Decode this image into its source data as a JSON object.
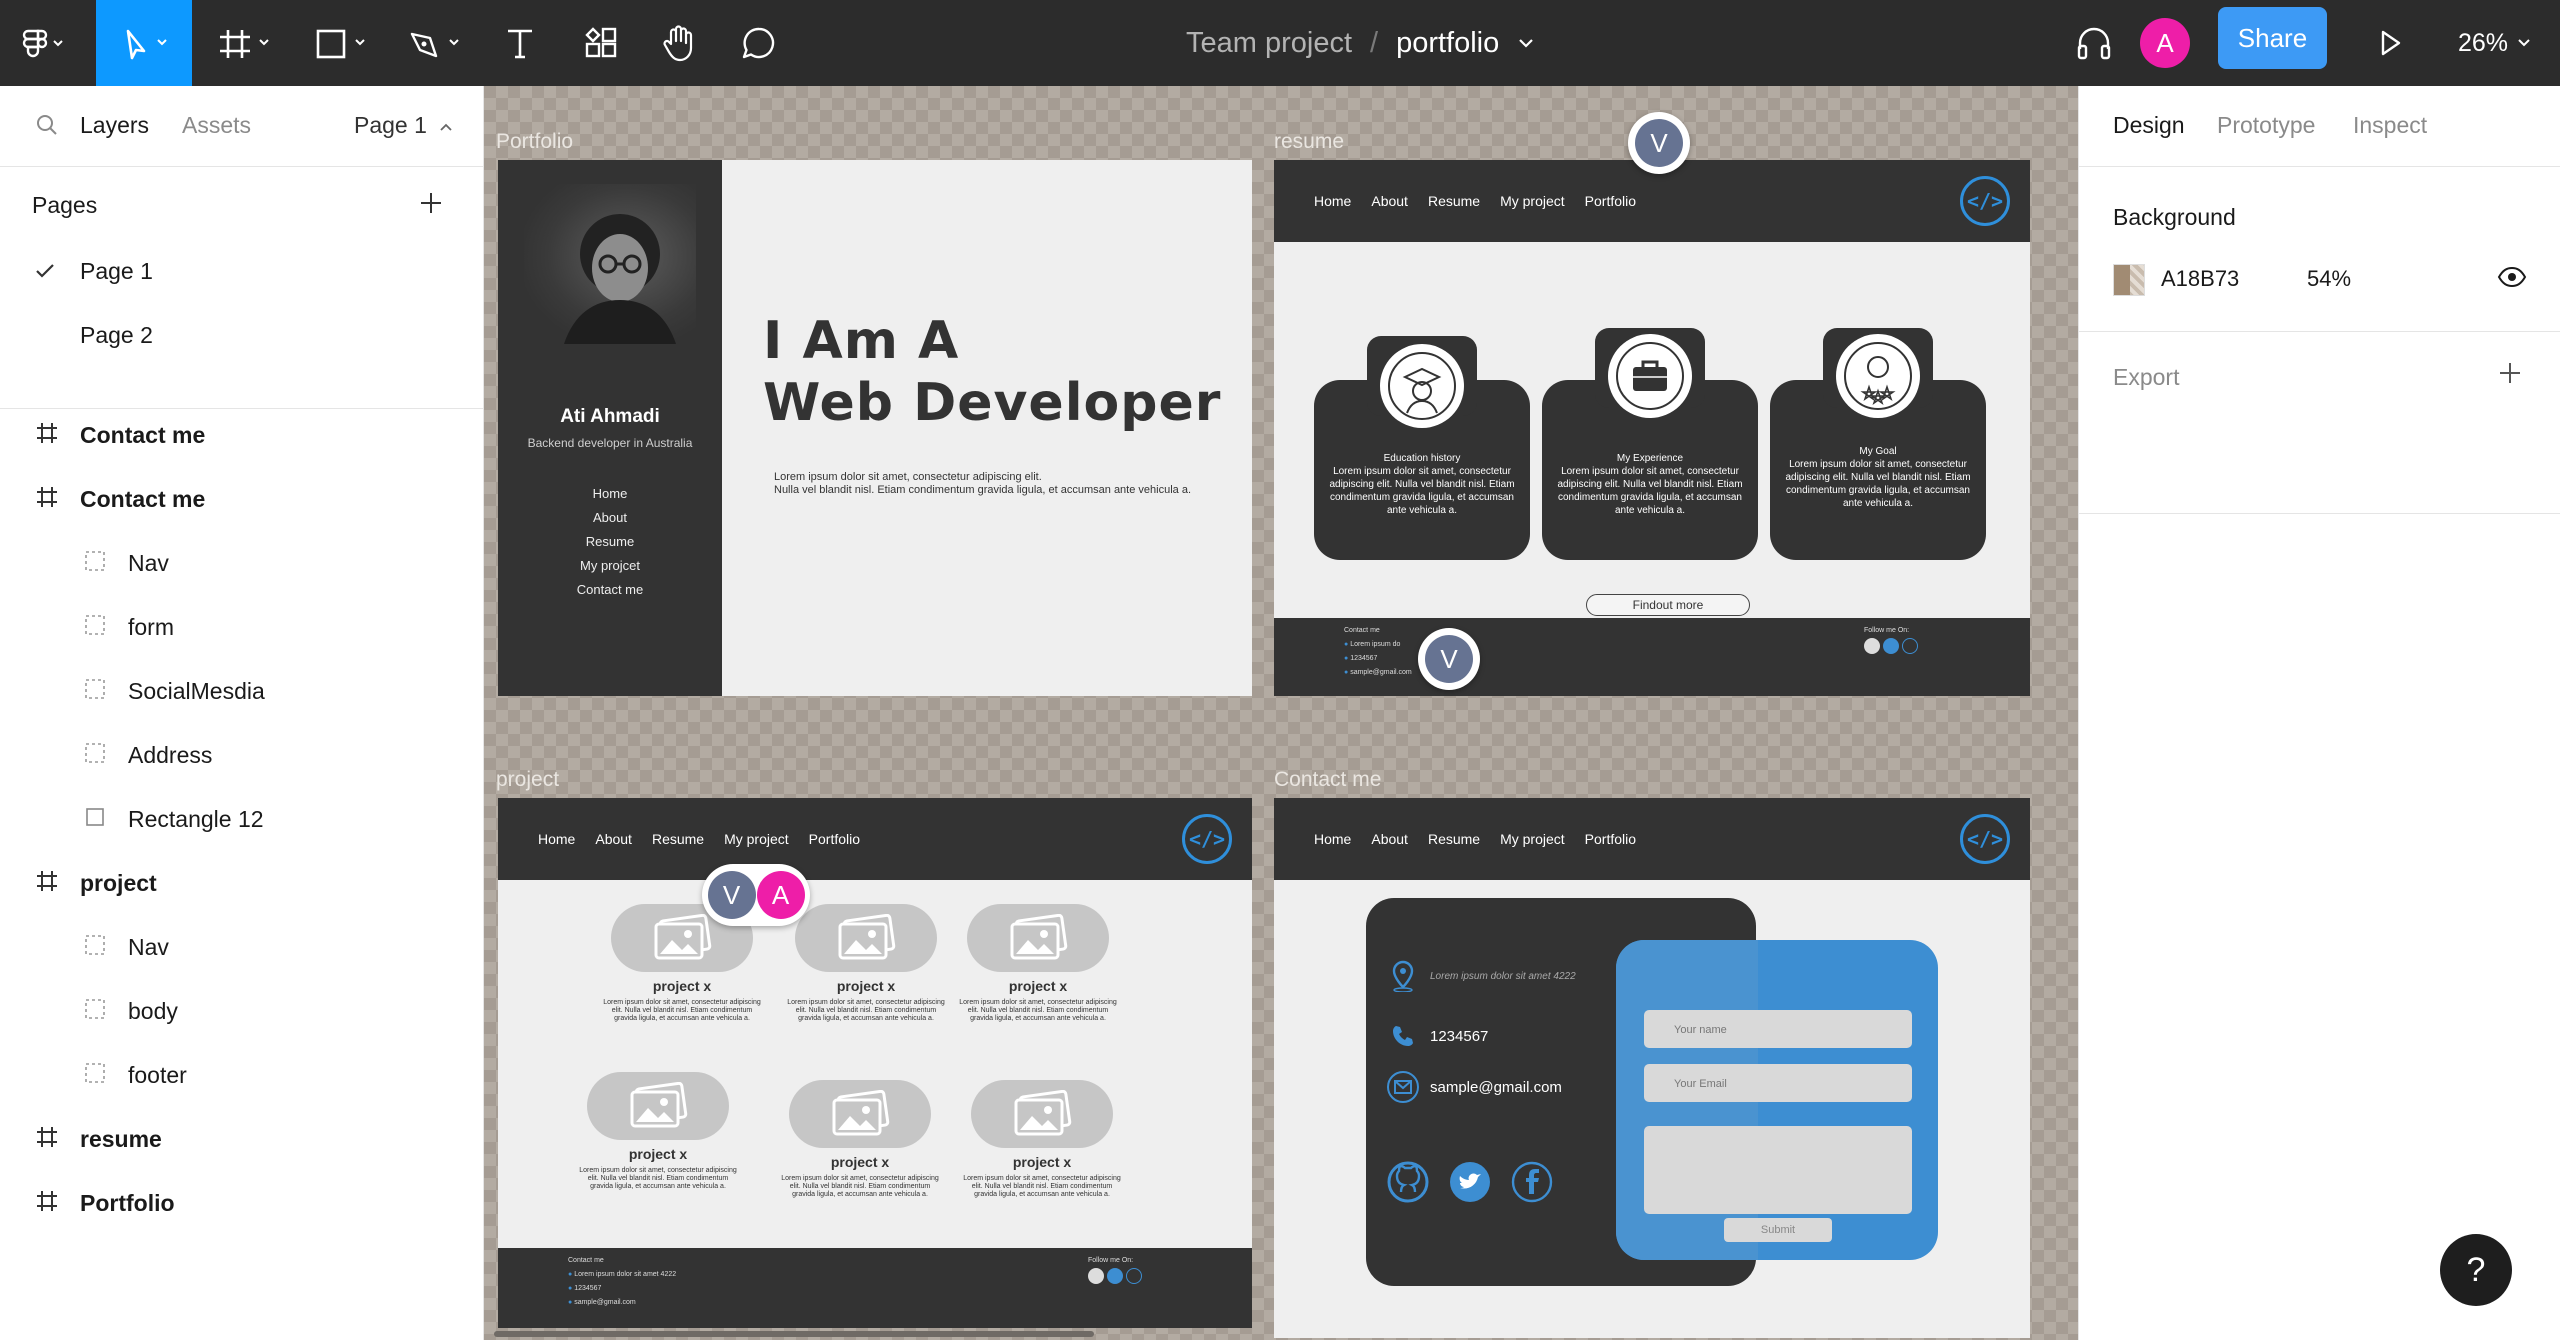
{
  "toolbar": {
    "project": "Team project",
    "separator": "/",
    "file": "portfolio",
    "share": "Share",
    "avatar": "A",
    "zoom": "26%",
    "icons": [
      "figma-menu-icon",
      "move-tool-icon",
      "frame-tool-icon",
      "shape-tool-icon",
      "pen-tool-icon",
      "text-tool-icon",
      "resources-icon",
      "hand-tool-icon",
      "comment-icon",
      "headphones-icon",
      "present-icon"
    ]
  },
  "left": {
    "tabs": [
      "Layers",
      "Assets"
    ],
    "page_selector": "Page 1",
    "pages_heading": "Pages",
    "pages": [
      "Page 1",
      "Page 2"
    ],
    "layers": [
      {
        "name": "Contact me",
        "kind": "frame",
        "depth": 0
      },
      {
        "name": "Contact me",
        "kind": "frame",
        "depth": 0
      },
      {
        "name": "Nav",
        "kind": "group",
        "depth": 1
      },
      {
        "name": "form",
        "kind": "group",
        "depth": 1
      },
      {
        "name": "SocialMesdia",
        "kind": "group",
        "depth": 1
      },
      {
        "name": "Address",
        "kind": "group",
        "depth": 1
      },
      {
        "name": "Rectangle 12",
        "kind": "rect",
        "depth": 1
      },
      {
        "name": "project",
        "kind": "frame",
        "depth": 0
      },
      {
        "name": "Nav",
        "kind": "group",
        "depth": 1
      },
      {
        "name": "body",
        "kind": "group",
        "depth": 1
      },
      {
        "name": "footer",
        "kind": "group",
        "depth": 1
      },
      {
        "name": "resume",
        "kind": "frame",
        "depth": 0
      },
      {
        "name": "Portfolio",
        "kind": "frame",
        "depth": 0
      }
    ]
  },
  "canvas": {
    "frame_labels": [
      "Portfolio",
      "resume",
      "project",
      "Contact me"
    ],
    "portfolio": {
      "name": "Ati Ahmadi",
      "role": "Backend developer in Australia",
      "nav": [
        "Home",
        "About",
        "Resume",
        "My projcet",
        "Contact me"
      ],
      "hero_line1": "I Am A",
      "hero_line2": "Web Developer",
      "lorem1": "Lorem ipsum dolor sit amet, consectetur adipiscing elit.",
      "lorem2": "Nulla vel blandit nisl. Etiam condimentum gravida ligula, et accumsan ante vehicula a."
    },
    "site_nav": [
      "Home",
      "About",
      "Resume",
      "My project",
      "Portfolio"
    ],
    "logo": "</>",
    "resume": {
      "cards": [
        {
          "title": "Education history",
          "icon": "graduate-icon"
        },
        {
          "title": "My Experience",
          "icon": "briefcase-icon"
        },
        {
          "title": "My Goal",
          "icon": "achievement-icon"
        }
      ],
      "card_text": "Lorem ipsum dolor sit amet, consectetur adipiscing elit.  Nulla vel blandit nisl. Etiam condimentum gravida ligula, et accumsan ante vehicula a.",
      "findout": "Findout more"
    },
    "footer": {
      "contact_title": "Contact me",
      "address": "Lorem ipsum dolor sit amet 4222",
      "address_short": "Lorem ipsum do",
      "phone": "1234567",
      "email": "sample@gmail.com",
      "follow": "Follow me On:"
    },
    "project": {
      "title": "project x",
      "desc": "Lorem ipsum dolor sit amet, consectetur adipiscing elit. Nulla vel blandit nisl. Etiam condimentum gravida ligula, et accumsan ante vehicula a."
    },
    "contact": {
      "address": "Lorem ipsum dolor sit amet 4222",
      "phone": "1234567",
      "email": "sample@gmail.com",
      "name_ph": "Your name",
      "email_ph": "Your Email",
      "submit": "Submit"
    },
    "collaborators": [
      "V",
      "V",
      "V",
      "A"
    ]
  },
  "right": {
    "tabs": [
      "Design",
      "Prototype",
      "Inspect"
    ],
    "background_heading": "Background",
    "bg_hex": "A18B73",
    "bg_opacity": "54%",
    "export_heading": "Export",
    "help": "?"
  },
  "colors": {
    "toolbar": "#2c2c2c",
    "accent": "#0d99ff",
    "share": "#3d9af5",
    "avatar_a": "#ee1ea8",
    "avatar_v": "#667392",
    "dark_card": "#333333",
    "form_blue": "#3d8ed2"
  }
}
